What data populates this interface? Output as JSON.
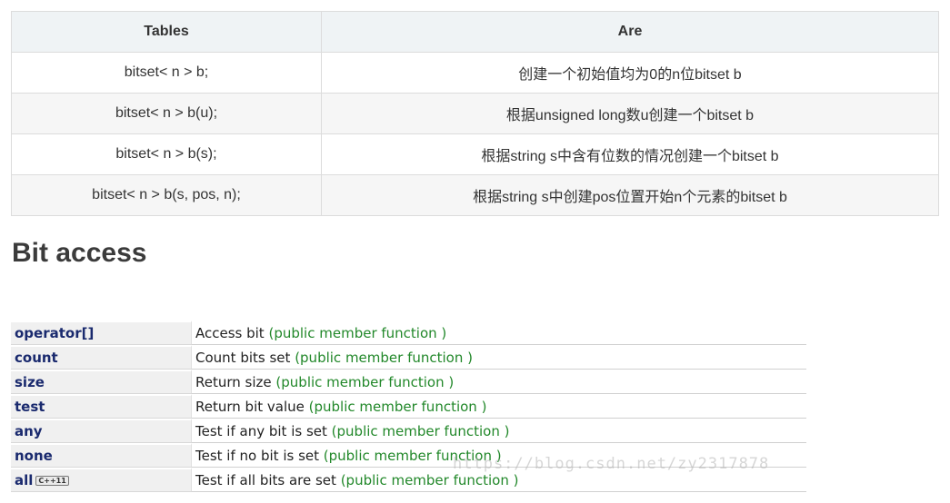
{
  "top_table": {
    "headers": [
      "Tables",
      "Are"
    ],
    "rows": [
      [
        "bitset< n > b;",
        "创建一个初始值均为0的n位bitset b"
      ],
      [
        "bitset< n > b(u);",
        "根据unsigned long数u创建一个bitset b"
      ],
      [
        "bitset< n > b(s);",
        "根据string s中含有位数的情况创建一个bitset b"
      ],
      [
        "bitset< n > b(s, pos, n);",
        "根据string s中创建pos位置开始n个元素的bitset b"
      ]
    ]
  },
  "heading": "Bit access",
  "ref_table": {
    "rows": [
      {
        "name": "operator[]",
        "desc": "Access bit",
        "kind": "(public member function )"
      },
      {
        "name": "count",
        "desc": "Count bits set",
        "kind": "(public member function )"
      },
      {
        "name": "size",
        "desc": "Return size",
        "kind": "(public member function )"
      },
      {
        "name": "test",
        "desc": "Return bit value",
        "kind": "(public member function )"
      },
      {
        "name": "any",
        "desc": "Test if any bit is set",
        "kind": "(public member function )"
      },
      {
        "name": "none",
        "desc": "Test if no bit is set",
        "kind": "(public member function )"
      },
      {
        "name": "all",
        "badge": "C++11",
        "desc": "Test if all bits are set",
        "kind": "(public member function )"
      }
    ]
  },
  "watermark": "https://blog.csdn.net/zy2317878",
  "colors": {
    "name_text": "#1a2a6e",
    "kind_text": "#22882a",
    "header_bg": "#eff3f5"
  }
}
